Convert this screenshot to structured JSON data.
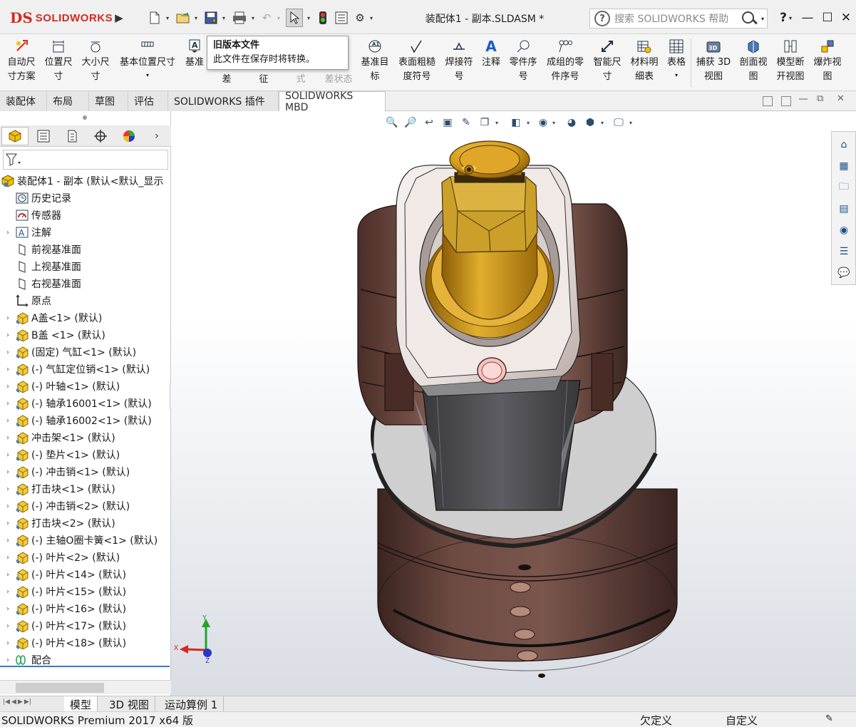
{
  "app": {
    "logo_prefix": "DS",
    "logo_text": "SOLIDWORKS",
    "document_title": "装配体1 - 副本.SLDASM *"
  },
  "search": {
    "placeholder": "搜索 SOLIDWORKS 帮助",
    "help_icon": "?"
  },
  "window_buttons": {
    "help": "?",
    "minimize": "—",
    "maximize": "☐",
    "close": "✕"
  },
  "ribbon": {
    "buttons": [
      {
        "label": "自动尺\n寸方案",
        "icon": "auto-dimension-icon"
      },
      {
        "label": "位置尺\n寸",
        "icon": "location-dimension-icon"
      },
      {
        "label": "大小尺\n寸",
        "icon": "size-dimension-icon"
      },
      {
        "label": "基本位置尺寸",
        "icon": "basic-location-dimension-icon"
      },
      {
        "label": "基准",
        "icon": "datum-icon"
      },
      {
        "label": "差",
        "icon": "tolerance-icon"
      },
      {
        "label": "征",
        "icon": "feature-icon"
      },
      {
        "label": "式",
        "icon": "formula-icon"
      },
      {
        "label": "差状态",
        "icon": "tolerance-status-icon"
      },
      {
        "label": "基准目\n标",
        "icon": "datum-target-icon"
      },
      {
        "label": "表面粗糙\n度符号",
        "icon": "surface-finish-icon"
      },
      {
        "label": "焊接符\n号",
        "icon": "weld-symbol-icon"
      },
      {
        "label": "注释",
        "icon": "note-icon"
      },
      {
        "label": "零件序\n号",
        "icon": "balloon-icon"
      },
      {
        "label": "成组的零\n件序号",
        "icon": "stacked-balloon-icon"
      },
      {
        "label": "智能尺\n寸",
        "icon": "smart-dimension-icon"
      },
      {
        "label": "材料明\n细表",
        "icon": "bom-icon"
      },
      {
        "label": "表格",
        "icon": "table-icon"
      },
      {
        "label": "捕获 3D\n视图",
        "icon": "capture-3d-view-icon"
      },
      {
        "label": "剖面视\n图",
        "icon": "section-view-icon"
      },
      {
        "label": "模型断\n开视图",
        "icon": "model-break-view-icon"
      },
      {
        "label": "爆炸视\n图",
        "icon": "exploded-view-icon"
      }
    ]
  },
  "tooltip": {
    "title": "旧版本文件",
    "body": "此文件在保存时将转换。"
  },
  "tabs": [
    {
      "label": "装配体",
      "active": false
    },
    {
      "label": "布局",
      "active": false
    },
    {
      "label": "草图",
      "active": false
    },
    {
      "label": "评估",
      "active": false
    },
    {
      "label": "SOLIDWORKS 插件",
      "active": false
    },
    {
      "label": "SOLIDWORKS MBD",
      "active": true
    }
  ],
  "tree": {
    "root": "装配体1 - 副本 (默认<默认_显示",
    "items": [
      {
        "label": "历史记录",
        "type": "history",
        "expand": false
      },
      {
        "label": "传感器",
        "type": "sensor",
        "expand": false
      },
      {
        "label": "注解",
        "type": "annotation",
        "expand": true
      },
      {
        "label": "前视基准面",
        "type": "plane",
        "expand": false
      },
      {
        "label": "上视基准面",
        "type": "plane",
        "expand": false
      },
      {
        "label": "右视基准面",
        "type": "plane",
        "expand": false
      },
      {
        "label": "原点",
        "type": "origin",
        "expand": false
      },
      {
        "label": "A盖<1> (默认)",
        "type": "part",
        "expand": true
      },
      {
        "label": "B盖 <1> (默认)",
        "type": "part",
        "expand": true
      },
      {
        "label": "(固定) 气缸<1> (默认)",
        "type": "part",
        "expand": true
      },
      {
        "label": "(-) 气缸定位销<1> (默认)",
        "type": "part",
        "expand": true
      },
      {
        "label": "(-) 叶轴<1> (默认)",
        "type": "part",
        "expand": true
      },
      {
        "label": "(-) 轴承16001<1> (默认)",
        "type": "part",
        "expand": true
      },
      {
        "label": "(-) 轴承16002<1> (默认)",
        "type": "part",
        "expand": true
      },
      {
        "label": "冲击架<1> (默认)",
        "type": "part",
        "expand": true
      },
      {
        "label": "(-) 垫片<1> (默认)",
        "type": "part",
        "expand": true
      },
      {
        "label": "(-) 冲击销<1> (默认)",
        "type": "part",
        "expand": true
      },
      {
        "label": "打击块<1> (默认)",
        "type": "part",
        "expand": true
      },
      {
        "label": "(-) 冲击销<2> (默认)",
        "type": "part",
        "expand": true
      },
      {
        "label": "打击块<2> (默认)",
        "type": "part",
        "expand": true
      },
      {
        "label": "(-) 主轴O圈卡簧<1> (默认)",
        "type": "part",
        "expand": true
      },
      {
        "label": "(-) 叶片<2> (默认)",
        "type": "part",
        "expand": true
      },
      {
        "label": "(-) 叶片<14> (默认)",
        "type": "part",
        "expand": true
      },
      {
        "label": "(-) 叶片<15> (默认)",
        "type": "part",
        "expand": true
      },
      {
        "label": "(-) 叶片<16> (默认)",
        "type": "part",
        "expand": true
      },
      {
        "label": "(-) 叶片<17> (默认)",
        "type": "part",
        "expand": true
      },
      {
        "label": "(-) 叶片<18> (默认)",
        "type": "part",
        "expand": true
      },
      {
        "label": "配合",
        "type": "mates",
        "expand": true
      }
    ]
  },
  "bottom_tabs": [
    {
      "label": "模型",
      "active": true
    },
    {
      "label": "3D 视图",
      "active": false
    },
    {
      "label": "运动算例 1",
      "active": false
    }
  ],
  "status": {
    "product": "SOLIDWORKS Premium 2017 x64 版",
    "definition": "欠定义",
    "custom": "自定义"
  },
  "triad": {
    "x": "X",
    "y": "Y",
    "z": "Z"
  },
  "colors": {
    "brand_red": "#d42a1f",
    "brass": "#d9a21f",
    "housing_brown": "#6b3d34",
    "flange_gray": "#c9c9c9"
  }
}
